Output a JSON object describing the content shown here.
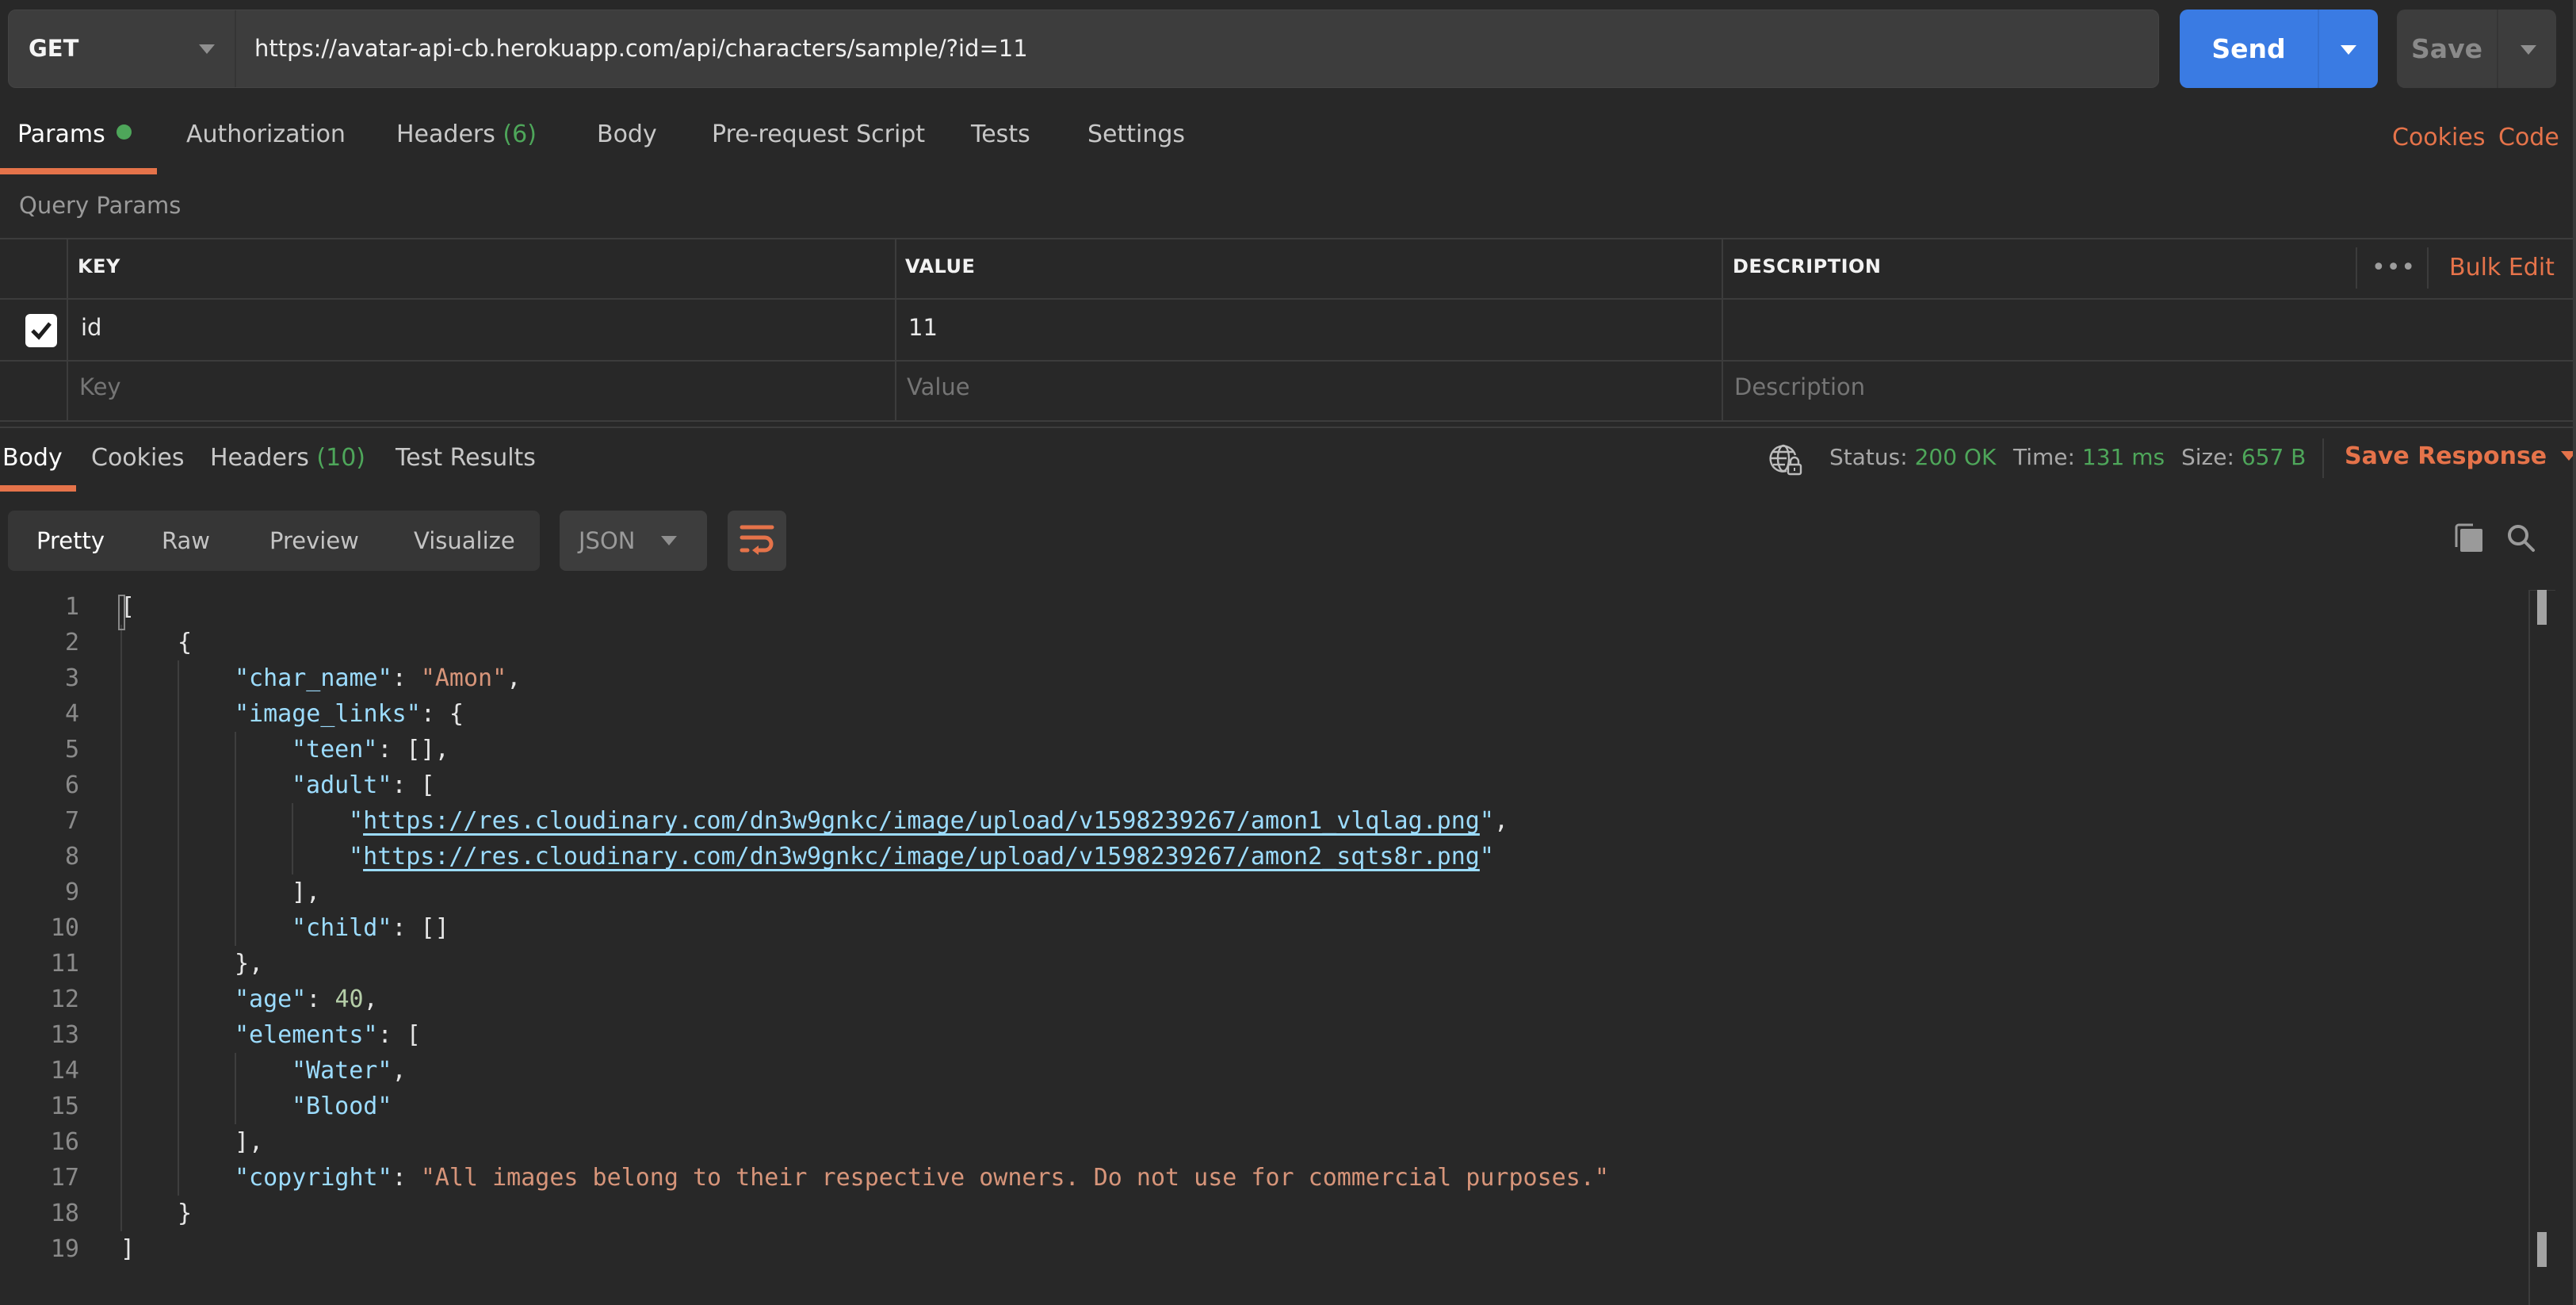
{
  "request": {
    "method": "GET",
    "url": "https://avatar-api-cb.herokuapp.com/api/characters/sample/?id=11",
    "send_label": "Send",
    "save_label": "Save"
  },
  "request_tabs": [
    {
      "label": "Params",
      "active": true,
      "indicator": "green-dot"
    },
    {
      "label": "Authorization"
    },
    {
      "label": "Headers",
      "count": "(6)"
    },
    {
      "label": "Body"
    },
    {
      "label": "Pre-request Script"
    },
    {
      "label": "Tests"
    },
    {
      "label": "Settings"
    }
  ],
  "request_links": {
    "cookies": "Cookies",
    "code": "Code"
  },
  "query_params": {
    "title": "Query Params",
    "columns": [
      "KEY",
      "VALUE",
      "DESCRIPTION"
    ],
    "more_label": "•••",
    "bulk_edit": "Bulk Edit",
    "rows": [
      {
        "checked": true,
        "key": "id",
        "value": "11",
        "description": ""
      }
    ],
    "placeholders": {
      "key": "Key",
      "value": "Value",
      "description": "Description"
    }
  },
  "response_tabs": [
    {
      "label": "Body",
      "active": true
    },
    {
      "label": "Cookies"
    },
    {
      "label": "Headers",
      "count": "(10)"
    },
    {
      "label": "Test Results"
    }
  ],
  "response_meta": {
    "status_label": "Status:",
    "status": "200 OK",
    "time_label": "Time:",
    "time": "131 ms",
    "size_label": "Size:",
    "size": "657 B",
    "save_response": "Save Response"
  },
  "view_modes": [
    "Pretty",
    "Raw",
    "Preview",
    "Visualize"
  ],
  "active_view": "Pretty",
  "format": "JSON",
  "icons": {
    "globe": "globe-lock-icon",
    "copy": "copy-icon",
    "search": "search-icon",
    "wrap": "wrap-lines-icon"
  },
  "colors": {
    "accent": "#e5734a",
    "send": "#3a7be3",
    "success": "#4ea65a",
    "json_key": "#9cdcfe",
    "json_string": "#d7957a",
    "json_number": "#b5cea8"
  },
  "response_body": {
    "lines": [
      {
        "n": "1",
        "indent": 0,
        "tokens": [
          [
            "p",
            "["
          ]
        ]
      },
      {
        "n": "2",
        "indent": 1,
        "tokens": [
          [
            "p",
            "{"
          ]
        ]
      },
      {
        "n": "3",
        "indent": 2,
        "tokens": [
          [
            "k",
            "\"char_name\""
          ],
          [
            "p",
            ": "
          ],
          [
            "s",
            "\"Amon\""
          ],
          [
            "p",
            ","
          ]
        ]
      },
      {
        "n": "4",
        "indent": 2,
        "tokens": [
          [
            "k",
            "\"image_links\""
          ],
          [
            "p",
            ": {"
          ]
        ]
      },
      {
        "n": "5",
        "indent": 3,
        "tokens": [
          [
            "k",
            "\"teen\""
          ],
          [
            "p",
            ": [],"
          ]
        ]
      },
      {
        "n": "6",
        "indent": 3,
        "tokens": [
          [
            "k",
            "\"adult\""
          ],
          [
            "p",
            ": ["
          ]
        ]
      },
      {
        "n": "7",
        "indent": 4,
        "tokens": [
          [
            "k",
            "\""
          ],
          [
            "u",
            "https://res.cloudinary.com/dn3w9gnkc/image/upload/v1598239267/amon1_vlqlag.png"
          ],
          [
            "k",
            "\""
          ],
          [
            "p",
            ","
          ]
        ]
      },
      {
        "n": "8",
        "indent": 4,
        "tokens": [
          [
            "k",
            "\""
          ],
          [
            "u",
            "https://res.cloudinary.com/dn3w9gnkc/image/upload/v1598239267/amon2_sqts8r.png"
          ],
          [
            "k",
            "\""
          ]
        ]
      },
      {
        "n": "9",
        "indent": 3,
        "tokens": [
          [
            "p",
            "],"
          ]
        ]
      },
      {
        "n": "10",
        "indent": 3,
        "tokens": [
          [
            "k",
            "\"child\""
          ],
          [
            "p",
            ": []"
          ]
        ]
      },
      {
        "n": "11",
        "indent": 2,
        "tokens": [
          [
            "p",
            "},"
          ]
        ]
      },
      {
        "n": "12",
        "indent": 2,
        "tokens": [
          [
            "k",
            "\"age\""
          ],
          [
            "p",
            ": "
          ],
          [
            "n",
            "40"
          ],
          [
            "p",
            ","
          ]
        ]
      },
      {
        "n": "13",
        "indent": 2,
        "tokens": [
          [
            "k",
            "\"elements\""
          ],
          [
            "p",
            ": ["
          ]
        ]
      },
      {
        "n": "14",
        "indent": 3,
        "tokens": [
          [
            "k",
            "\"Water\""
          ],
          [
            "p",
            ","
          ]
        ]
      },
      {
        "n": "15",
        "indent": 3,
        "tokens": [
          [
            "k",
            "\"Blood\""
          ]
        ]
      },
      {
        "n": "16",
        "indent": 2,
        "tokens": [
          [
            "p",
            "],"
          ]
        ]
      },
      {
        "n": "17",
        "indent": 2,
        "tokens": [
          [
            "k",
            "\"copyright\""
          ],
          [
            "p",
            ": "
          ],
          [
            "s",
            "\"All images belong to their respective owners. Do not use for commercial purposes.\""
          ]
        ]
      },
      {
        "n": "18",
        "indent": 1,
        "tokens": [
          [
            "p",
            "}"
          ]
        ]
      },
      {
        "n": "19",
        "indent": 0,
        "tokens": [
          [
            "p",
            "]"
          ]
        ]
      }
    ]
  }
}
